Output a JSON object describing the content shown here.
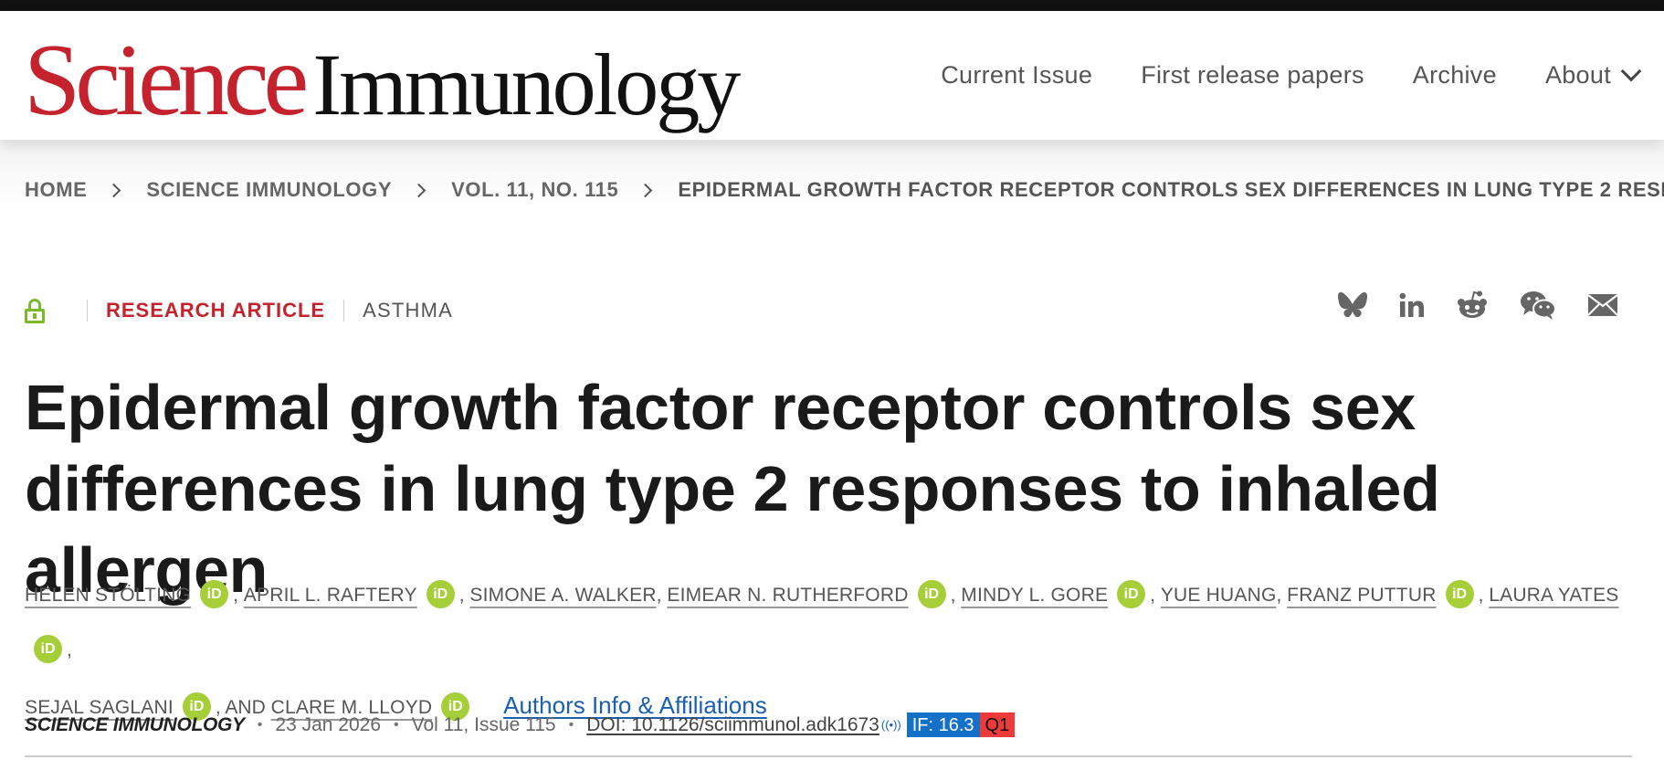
{
  "header": {
    "logo_science": "Science",
    "logo_journal": "Immunology",
    "nav": [
      {
        "label": "Current Issue"
      },
      {
        "label": "First release papers"
      },
      {
        "label": "Archive"
      },
      {
        "label": "About"
      }
    ]
  },
  "breadcrumb": [
    "HOME",
    "SCIENCE IMMUNOLOGY",
    "VOL. 11, NO. 115",
    "EPIDERMAL GROWTH FACTOR RECEPTOR CONTROLS SEX DIFFERENCES IN LUNG TYPE 2 RESPONSES TO INHALED ALLERGEN"
  ],
  "article": {
    "access_icon": "open-lock-icon",
    "type": "RESEARCH ARTICLE",
    "subject": "ASTHMA",
    "title": "Epidermal growth factor receptor controls sex differ­ences in lung type 2 responses to inhaled allergen",
    "share_icons": [
      "bluesky-icon",
      "linkedin-icon",
      "reddit-icon",
      "wechat-icon",
      "email-icon"
    ],
    "orcid_badge": "iD",
    "authors": [
      {
        "name": "HELEN STÖLTING",
        "orcid": true
      },
      {
        "name": "APRIL L. RAFTERY",
        "orcid": true
      },
      {
        "name": "SIMONE A. WALKER",
        "orcid": false
      },
      {
        "name": "EIMEAR N. RUTHERFORD",
        "orcid": true
      },
      {
        "name": "MINDY L. GORE",
        "orcid": true
      },
      {
        "name": "YUE HUANG",
        "orcid": false
      },
      {
        "name": "FRANZ PUTTUR",
        "orcid": true
      },
      {
        "name": "LAURA YATES",
        "orcid": true
      },
      {
        "name": "SEJAL SAGLANI",
        "orcid": true
      },
      {
        "name": "CLARE M. LLOYD",
        "orcid": true
      }
    ],
    "and_text": "AND",
    "authors_info_link": "Authors Info & Affiliations"
  },
  "publication": {
    "journal": "SCIENCE IMMUNOLOGY",
    "date": "23 Jan 2026",
    "volume_issue": "Vol 11, Issue 115",
    "doi": "DOI: 10.1126/sciimmunol.adk1673",
    "altmetric_glyph": "((•))",
    "impact_factor": "IF: 16.3",
    "quartile": "Q1",
    "colors": {
      "if_badge": "#1570c7",
      "quartile_badge": "#ee3a3a"
    }
  },
  "colors": {
    "brand_red": "#c4222c",
    "orcid_green": "#a6ce39",
    "link_blue": "#1a5fb4",
    "open_access_green": "#7ab929"
  }
}
